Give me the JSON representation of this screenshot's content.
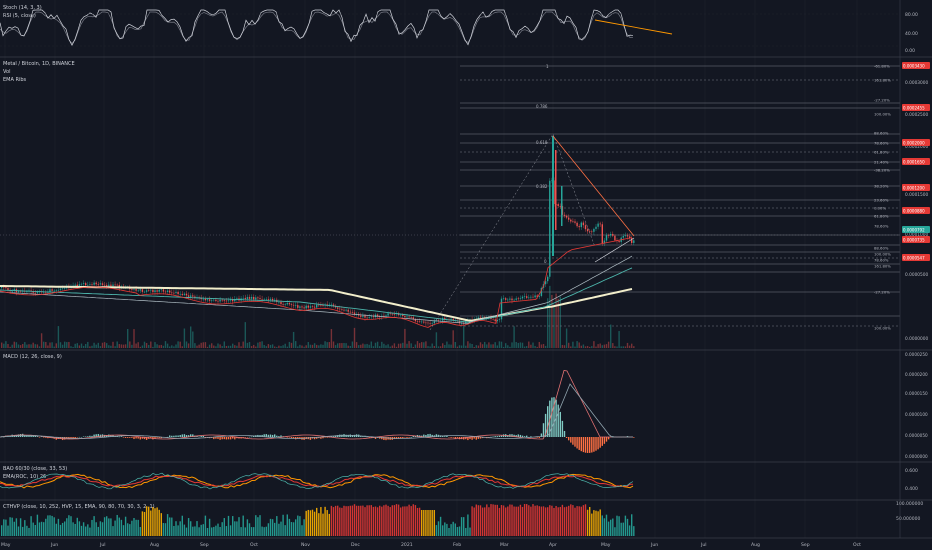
{
  "colors": {
    "bg": "#131722",
    "grid": "#1e222d",
    "separator": "#3a3e4a",
    "axis_text": "#b2b5be",
    "pane_title": "#d1d4dc",
    "candle_up": "#26a69a",
    "candle_down": "#ef5350",
    "ema_white": "#f2eecb",
    "ema_teal": "#4db6ac",
    "ema_blue": "#b0bec5",
    "ema_red": "#e53935",
    "fib_line": "#787b86",
    "stoch_k": "#d1d4dc",
    "stoch_d": "#787b86",
    "trend_orange": "#ff9800",
    "macd_hist_up": "#80cbc4",
    "macd_hist_down": "#ff7043",
    "macd_line": "#e57373",
    "signal_line": "#90a4ae",
    "bar_yellow": "#ffb300",
    "bar_red": "#e53935",
    "badge_red": "#e53935",
    "badge_green": "#26a69a"
  },
  "panes": {
    "stoch": {
      "title": "Stoch (14, 3, 3)",
      "subtitle": "RSI (5, close)",
      "axis_ticks": [
        "80.00",
        "40.00",
        "0.00"
      ]
    },
    "main": {
      "title": "Metal / Bitcoin, 1D, BINANCE",
      "vol": "Vol",
      "ema": "EMA Ribs",
      "axis_ticks": [
        "0.0003000",
        "0.0002500",
        "0.0002000",
        "0.0001500",
        "0.0001000",
        "0.0000500",
        "0.0000000"
      ],
      "fib_left_labels": [
        "1",
        "0.786",
        "0.618",
        "0.382",
        "0"
      ],
      "fib_right_labels": [
        "-61.80%",
        "161.80%",
        "-27.20%",
        "100.00%",
        "88.60%",
        "78.60%",
        "61.80%",
        "21.40%",
        "-38.20%",
        "38.20%",
        "23.60%",
        "0.00%",
        "61.80%",
        "78.60%",
        "88.60%",
        "100.00%",
        "78.60%",
        "161.80%",
        "-27.20%",
        "100.00%"
      ],
      "badges": [
        {
          "text": "0.0003430",
          "kind": "red"
        },
        {
          "text": "0.0002455",
          "kind": "red"
        },
        {
          "text": "0.0002000",
          "kind": "red"
        },
        {
          "text": "0.0001650",
          "kind": "red"
        },
        {
          "text": "0.0001200",
          "kind": "red"
        },
        {
          "text": "0.0000880",
          "kind": "red"
        },
        {
          "text": "0.0000792",
          "kind": "green"
        },
        {
          "text": "0.0000735",
          "kind": "red"
        },
        {
          "text": "0.0000547",
          "kind": "red"
        }
      ]
    },
    "macd": {
      "title": "MACD (12, 26, close, 9)",
      "axis_ticks": [
        "0.0000250",
        "0.0000200",
        "0.0000150",
        "0.0000100",
        "0.0000050",
        "0.0000000",
        "-0.0000050"
      ]
    },
    "bao": {
      "title": "BAO 60/30 (close, 33, 53)",
      "subtitle": "EMA(ROC, 10) 26",
      "axis_ticks": [
        "0.600",
        "0.400"
      ]
    },
    "cthvp": {
      "title": "CTHVP (close, 10, 252, HVP, 15, EMA, 90, 80, 70, 30, 3, 2, 1)",
      "axis_ticks": [
        "100.000000",
        "50.000000"
      ]
    }
  },
  "x_axis": {
    "labels": [
      "May",
      "Jun",
      "Jul",
      "Aug",
      "Sep",
      "Oct",
      "Nov",
      "Dec",
      "2021",
      "Feb",
      "Mar",
      "Apr",
      "May",
      "Jun",
      "Jul",
      "Aug",
      "Sep",
      "Oct"
    ]
  }
}
